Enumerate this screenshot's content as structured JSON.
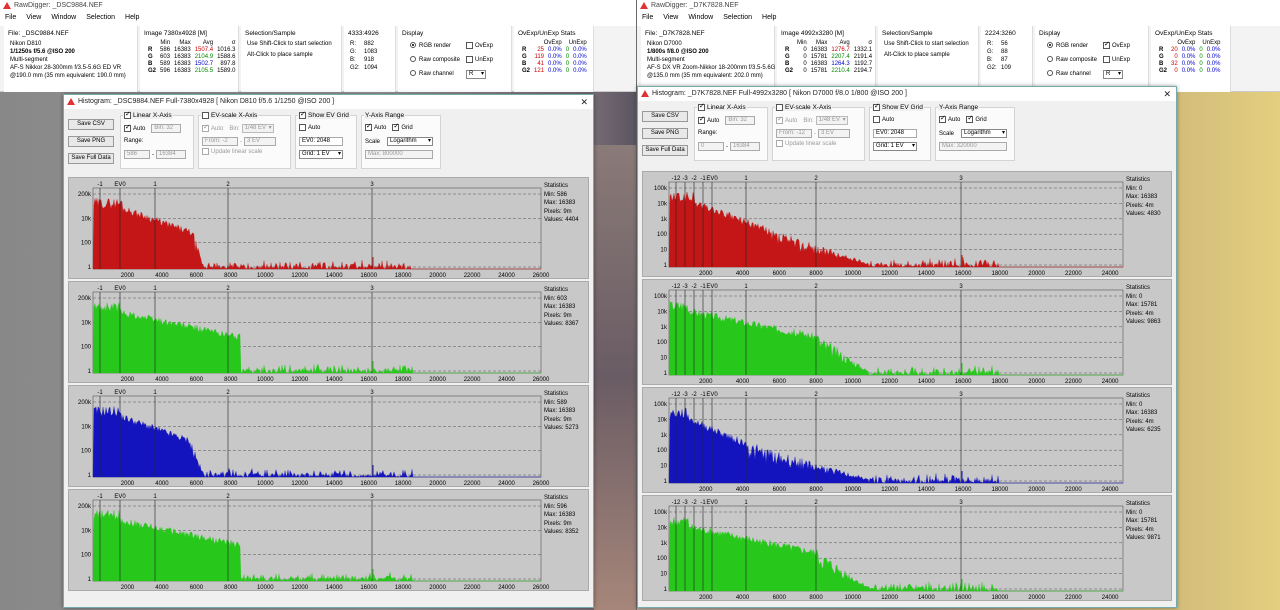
{
  "colors": {
    "red": "#c41616",
    "green": "#27c81b",
    "blue": "#1414bf",
    "panel_bg": "#c8c8c8"
  },
  "menu": [
    "File",
    "View",
    "Window",
    "Selection",
    "Help"
  ],
  "left": {
    "app_title": "RawDigger: _DSC9884.NEF",
    "file": {
      "label": "File: _DSC9884.NEF",
      "camera": "Nikon D810",
      "exposure": "1/1250s f/5.6 @ISO 200",
      "mode": "Multi-segment",
      "lens": "AF-S Nikkor 28-300mm f/3.5-5.6G ED VR",
      "focal": "@190.0 mm (35 mm equivalent: 190.0 mm)"
    },
    "image": {
      "label": "Image 7380x4928 [M]",
      "headers": [
        "Min",
        "Max",
        "Avg",
        "σ"
      ],
      "rows": [
        [
          "R",
          "586",
          "16383",
          "1507.4",
          "1016.3"
        ],
        [
          "G",
          "603",
          "16383",
          "2104.9",
          "1588.6"
        ],
        [
          "B",
          "589",
          "16383",
          "1502.7",
          "897.8"
        ],
        [
          "G2",
          "596",
          "16383",
          "2105.5",
          "1589.0"
        ]
      ]
    },
    "selection": {
      "label": "Selection/Sample",
      "line1": "Use Shift-Click to start selection",
      "line2": "Alt-Click to place sample"
    },
    "coords": {
      "label": "4333:4926",
      "rows": [
        [
          "R:",
          "882"
        ],
        [
          "G:",
          "1083"
        ],
        [
          "B:",
          "918"
        ],
        [
          "G2:",
          "1094"
        ]
      ]
    },
    "display": {
      "label": "Display",
      "opt1": "RGB render",
      "opt2": "Raw composite",
      "opt3": "Raw channel",
      "ovexp": "OvExp",
      "unexp": "UnExp",
      "ch": "R"
    },
    "ovstats": {
      "label": "OvExp/UnExp Stats",
      "headers": [
        "OvExp",
        "UnExp"
      ],
      "rows": [
        [
          "R",
          "25",
          "0.0%",
          "0",
          "0.0%"
        ],
        [
          "G",
          "119",
          "0.0%",
          "0",
          "0.0%"
        ],
        [
          "B",
          "41",
          "0.0%",
          "0",
          "0.0%"
        ],
        [
          "G2",
          "121",
          "0.0%",
          "0",
          "0.0%"
        ]
      ]
    },
    "hist": {
      "title": "Histogram: _DSC9884.NEF Full-7380x4928 [ Nikon D810 f/5.6 1/1250 @ISO 200 ]",
      "buttons": [
        "Save CSV",
        "Save PNG",
        "Save Full Data"
      ],
      "linear": {
        "label": "Linear X-Axis",
        "auto": "Auto",
        "bin": "Bin: 32",
        "range": "Range:",
        "from": "586",
        "to": "16384"
      },
      "evscale": {
        "label": "EV-scale X-Axis",
        "auto": "Auto",
        "bin": "Bin:",
        "binval": "1/48 EV",
        "from": "From: -2",
        "to": "3 EV",
        "update": "Update linear scale"
      },
      "evgrid": {
        "label": "Show EV Grid",
        "auto": "Auto",
        "ev0": "EV0: 2048",
        "grid": "Grid: 1 EV"
      },
      "yrange": {
        "label": "Y-Axis Range",
        "auto": "Auto",
        "grid": "Grid",
        "scale": "Scale",
        "scaleval": "Logarithm",
        "max": "Max: 800000"
      },
      "ev_labels": [
        "-1",
        "EV0",
        "1",
        "2",
        "3"
      ],
      "yticks": [
        "200k",
        "10k",
        "100",
        "1"
      ],
      "xticks": [
        "2000",
        "4000",
        "6000",
        "8000",
        "10000",
        "12000",
        "14000",
        "16000",
        "18000",
        "20000",
        "22000",
        "24000",
        "26000"
      ],
      "panels": [
        {
          "color": "red",
          "stats": [
            "Statistics",
            "Min: 586",
            "Max: 16383",
            "Pixels: 9m",
            "Values: 4404"
          ]
        },
        {
          "color": "green",
          "stats": [
            "Statistics",
            "Min: 603",
            "Max: 16383",
            "Pixels: 9m",
            "Values: 8367"
          ]
        },
        {
          "color": "blue",
          "stats": [
            "Statistics",
            "Min: 589",
            "Max: 16383",
            "Pixels: 9m",
            "Values: 5273"
          ]
        },
        {
          "color": "green",
          "stats": [
            "Statistics",
            "Min: 596",
            "Max: 16383",
            "Pixels: 9m",
            "Values: 8352"
          ]
        }
      ]
    }
  },
  "right": {
    "app_title": "RawDigger: _D7K7828.NEF",
    "file": {
      "label": "File: _D7K7828.NEF",
      "camera": "Nikon D7000",
      "exposure": "1/800s f/8.0 @ISO 200",
      "mode": "Multi-segment",
      "lens": "AF-S DX VR Zoom-Nikkor 18-200mm f/3.5-5.6G IF-ED [II]",
      "focal": "@135.0 mm (35 mm equivalent: 202.0 mm)"
    },
    "image": {
      "label": "Image 4992x3280 [M]",
      "headers": [
        "Min",
        "Max",
        "Avg",
        "σ"
      ],
      "rows": [
        [
          "R",
          "0",
          "16383",
          "1276.7",
          "1332.1"
        ],
        [
          "G",
          "0",
          "15781",
          "2207.4",
          "2191.4"
        ],
        [
          "B",
          "0",
          "16383",
          "1264.3",
          "1192.7"
        ],
        [
          "G2",
          "0",
          "15781",
          "2210.4",
          "2194.7"
        ]
      ]
    },
    "selection": {
      "label": "Selection/Sample",
      "line1": "Use Shift-Click to start selection",
      "line2": "Alt-Click to place sample"
    },
    "coords": {
      "label": "2224:3260",
      "rows": [
        [
          "R:",
          "56"
        ],
        [
          "G:",
          "88"
        ],
        [
          "B:",
          "87"
        ],
        [
          "G2:",
          "109"
        ]
      ]
    },
    "display": {
      "label": "Display",
      "opt1": "RGB render",
      "opt2": "Raw composite",
      "opt3": "Raw channel",
      "ovexp": "OvExp",
      "unexp": "UnExp",
      "ch": "R"
    },
    "ovstats": {
      "label": "OvExp/UnExp Stats",
      "headers": [
        "OvExp",
        "UnExp"
      ],
      "rows": [
        [
          "R",
          "20",
          "0.0%",
          "0",
          "0.0%"
        ],
        [
          "G",
          "0",
          "0.0%",
          "0",
          "0.0%"
        ],
        [
          "B",
          "32",
          "0.0%",
          "0",
          "0.0%"
        ],
        [
          "G2",
          "0",
          "0.0%",
          "0",
          "0.0%"
        ]
      ]
    },
    "hist": {
      "title": "Histogram: _D7K7828.NEF Full-4992x3280 [ Nikon D7000 f/8.0 1/800 @ISO 200 ]",
      "buttons": [
        "Save CSV",
        "Save PNG",
        "Save Full Data"
      ],
      "linear": {
        "label": "Linear X-Axis",
        "auto": "Auto",
        "bin": "Bin: 32",
        "range": "Range:",
        "from": "0",
        "to": "16384"
      },
      "evscale": {
        "label": "EV-scale X-Axis",
        "auto": "Auto",
        "bin": "Bin:",
        "binval": "1/48 EV",
        "from": "From: -12",
        "to": "3 EV",
        "update": "Update linear scale"
      },
      "evgrid": {
        "label": "Show EV Grid",
        "auto": "Auto",
        "ev0": "EV0: 2048",
        "grid": "Grid: 1 EV"
      },
      "yrange": {
        "label": "Y-Axis Range",
        "auto": "Auto",
        "grid": "Grid",
        "scale": "Scale",
        "scaleval": "Logarithm",
        "max": "Max: 320000"
      },
      "ev_labels": [
        "-12",
        "-3",
        "-2",
        "-1",
        "EV0",
        "1",
        "2",
        "3"
      ],
      "yticks": [
        "100k",
        "10k",
        "1k",
        "100",
        "10",
        "1"
      ],
      "xticks": [
        "2000",
        "4000",
        "6000",
        "8000",
        "10000",
        "12000",
        "14000",
        "16000",
        "18000",
        "20000",
        "22000",
        "24000"
      ],
      "panels": [
        {
          "color": "red",
          "stats": [
            "Statistics",
            "Min: 0",
            "Max: 16383",
            "Pixels: 4m",
            "Values: 4830"
          ]
        },
        {
          "color": "green",
          "stats": [
            "Statistics",
            "Min: 0",
            "Max: 15781",
            "Pixels: 4m",
            "Values: 9863"
          ]
        },
        {
          "color": "blue",
          "stats": [
            "Statistics",
            "Min: 0",
            "Max: 16383",
            "Pixels: 4m",
            "Values: 6235"
          ]
        },
        {
          "color": "green",
          "stats": [
            "Statistics",
            "Min: 0",
            "Max: 15781",
            "Pixels: 4m",
            "Values: 9871"
          ]
        }
      ]
    }
  }
}
